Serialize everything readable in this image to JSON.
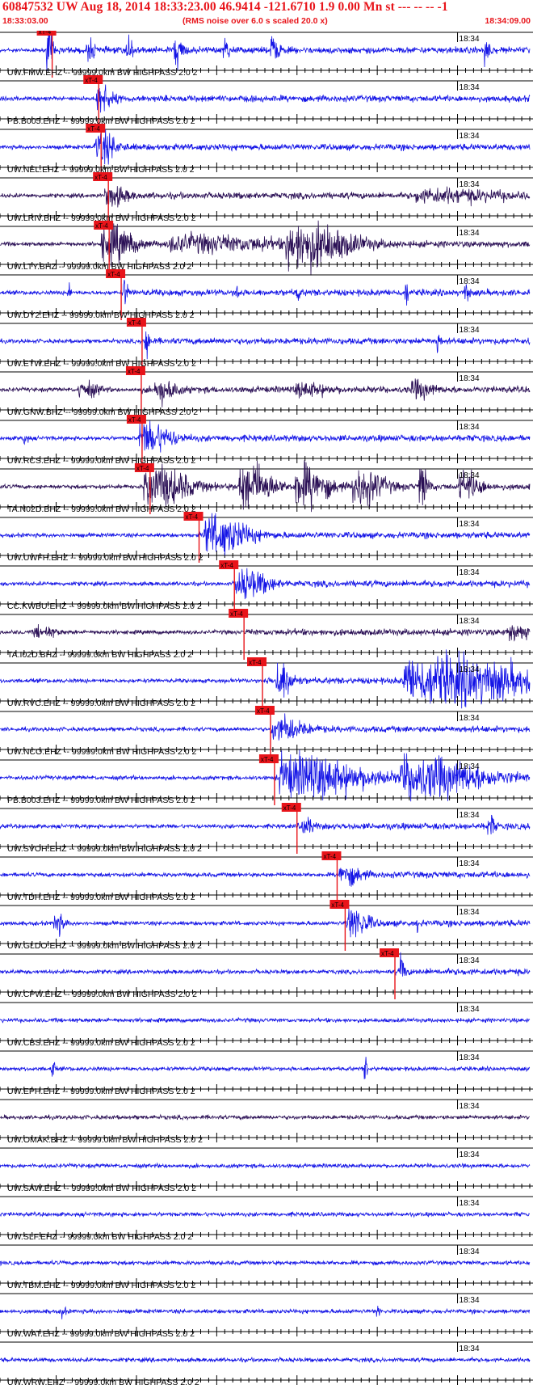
{
  "header": {
    "title": "60847532 UW Aug 18, 2014 18:33:23.00   46.9414 -121.6710  1.9 0.00 Mn st --- -- --  -1",
    "start_time": "18:33:03.00",
    "noise_note": "(RMS noise over 6.0 s scaled 20.0 x)",
    "end_time": "18:34:09.00"
  },
  "colors": {
    "header_text": "#e8141a",
    "trace_blue": "#1414e6",
    "trace_dark": "#2a0f55",
    "pick_red": "#e8141a",
    "axis": "#000000"
  },
  "chart_data": {
    "type": "line",
    "title": "",
    "xlabel": "",
    "ylabel": "",
    "x_range": [
      "18:33:03.00",
      "18:34:09.00"
    ],
    "minute_label": "18:34",
    "pick_label": "xT-4",
    "filter_text": "99999.0km BW  HIGHPASS  2.0  2",
    "traces": [
      {
        "station": "UW.FMW.EHZ",
        "color": "blue",
        "pick_s": 6.5,
        "label": "UW.FMW.EHZ -- 99999.0km BW  HIGHPASS  2.0  2"
      },
      {
        "station": "PB.B005.EHZ",
        "color": "blue",
        "pick_s": 12.3,
        "label": "PB.B005.EHZ -- 99999.0km BW  HIGHPASS  2.0  2"
      },
      {
        "station": "UW.NEL.EHZ",
        "color": "blue",
        "pick_s": 12.6,
        "label": "UW.NEL.EHZ -- 99999.0km BW  HIGHPASS  2.0  2"
      },
      {
        "station": "UW.LRIV.BHZ",
        "color": "dark",
        "pick_s": 13.5,
        "label": "UW.LRIV.BHZ -- 99999.0km BW  HIGHPASS  2.0  2"
      },
      {
        "station": "UW.LTY.BHZ",
        "color": "dark",
        "pick_s": 13.6,
        "label": "UW.LTY.BHZ -- 99999.0km BW  HIGHPASS  2.0  2"
      },
      {
        "station": "UW.DY2.EHZ",
        "color": "blue",
        "pick_s": 15.1,
        "label": "UW.DY2.EHZ -- 99999.0km BW  HIGHPASS  2.0  2"
      },
      {
        "station": "UW.ETW.EHZ",
        "color": "blue",
        "pick_s": 17.7,
        "label": "UW.ETW.EHZ -- 99999.0km BW  HIGHPASS  2.0  2"
      },
      {
        "station": "UW.GNW.BHZ",
        "color": "dark",
        "pick_s": 17.6,
        "label": "UW.GNW.BHZ -- 99999.0km BW  HIGHPASS  2.0  2"
      },
      {
        "station": "UW.RCS.EHZ",
        "color": "blue",
        "pick_s": 17.7,
        "label": "UW.RCS.EHZ -- 99999.0km BW  HIGHPASS  2.0  2"
      },
      {
        "station": "TA.N02D.BHZ",
        "color": "dark",
        "pick_s": 18.7,
        "label": "TA.N02D.BHZ -- 99999.0km BW  HIGHPASS  2.0  2"
      },
      {
        "station": "UW.UWFH.EHZ",
        "color": "blue",
        "pick_s": 24.8,
        "label": "UW.UWFH.EHZ -- 99999.0km BW  HIGHPASS  2.0  2"
      },
      {
        "station": "CC.KWBU.EHZ",
        "color": "blue",
        "pick_s": 29.2,
        "label": "CC.KWBU.EHZ -- 99999.0km BW  HIGHPASS  2.0  2"
      },
      {
        "station": "TA.I02D.BHZ",
        "color": "dark",
        "pick_s": 30.4,
        "label": "TA.I02D.BHZ -- 99999.0km BW  HIGHPASS  2.0  2"
      },
      {
        "station": "UW.RVC.EHZ",
        "color": "blue",
        "pick_s": 32.7,
        "label": "UW.RVC.EHZ -- 99999.0km BW  HIGHPASS  2.0  2"
      },
      {
        "station": "UW.NCO.EHZ",
        "color": "blue",
        "pick_s": 33.7,
        "label": "UW.NCO.EHZ -- 99999.0km BW  HIGHPASS  2.0  2"
      },
      {
        "station": "PB.B003.EHZ",
        "color": "blue",
        "pick_s": 34.2,
        "label": "PB.B003.EHZ -- 99999.0km BW  HIGHPASS  2.0  2"
      },
      {
        "station": "UW.SVOH.EHZ",
        "color": "blue",
        "pick_s": 37.0,
        "label": "UW.SVOH.EHZ -- 99999.0km BW  HIGHPASS  2.0  2"
      },
      {
        "station": "UW.TDH.EHZ",
        "color": "blue",
        "pick_s": 42.0,
        "label": "UW.TDH.EHZ -- 99999.0km BW  HIGHPASS  2.0  2"
      },
      {
        "station": "UW.GLDO.EHZ",
        "color": "blue",
        "pick_s": 43.0,
        "label": "UW.GLDO.EHZ -- 99999.0km BW  HIGHPASS  2.0  2"
      },
      {
        "station": "UW.CPW.EHZ",
        "color": "blue",
        "pick_s": 49.2,
        "label": "UW.CPW.EHZ -- 99999.0km BW  HIGHPASS  2.0  2"
      },
      {
        "station": "UW.CBS.EHZ",
        "color": "blue",
        "pick_s": null,
        "label": "UW.CBS.EHZ -- 99999.0km BW  HIGHPASS  2.0  2"
      },
      {
        "station": "UW.EPH.EHZ",
        "color": "blue",
        "pick_s": null,
        "label": "UW.EPH.EHZ -- 99999.0km BW  HIGHPASS  2.0  2"
      },
      {
        "station": "UW.OMAK.BHZ",
        "color": "dark",
        "pick_s": null,
        "label": "UW.OMAK.BHZ -- 99999.0km BW  HIGHPASS  2.0  2"
      },
      {
        "station": "UW.SAW.EHZ",
        "color": "blue",
        "pick_s": null,
        "label": "UW.SAW.EHZ -- 99999.0km BW  HIGHPASS  2.0  2"
      },
      {
        "station": "UW.SLF.EHZ",
        "color": "blue",
        "pick_s": null,
        "label": "UW.SLF.EHZ -- 99999.0km BW  HIGHPASS  2.0  2"
      },
      {
        "station": "UW.TBM.EHZ",
        "color": "blue",
        "pick_s": null,
        "label": "UW.TBM.EHZ -- 99999.0km BW  HIGHPASS  2.0  2"
      },
      {
        "station": "UW.WAT.EHZ",
        "color": "blue",
        "pick_s": null,
        "label": "UW.WAT.EHZ -- 99999.0km BW  HIGHPASS  2.0  2"
      },
      {
        "station": "UW.WRW.EHZ",
        "color": "blue",
        "pick_s": null,
        "label": "UW.WRW.EHZ -- 99999.0km BW  HIGHPASS  2.0  2"
      }
    ]
  }
}
